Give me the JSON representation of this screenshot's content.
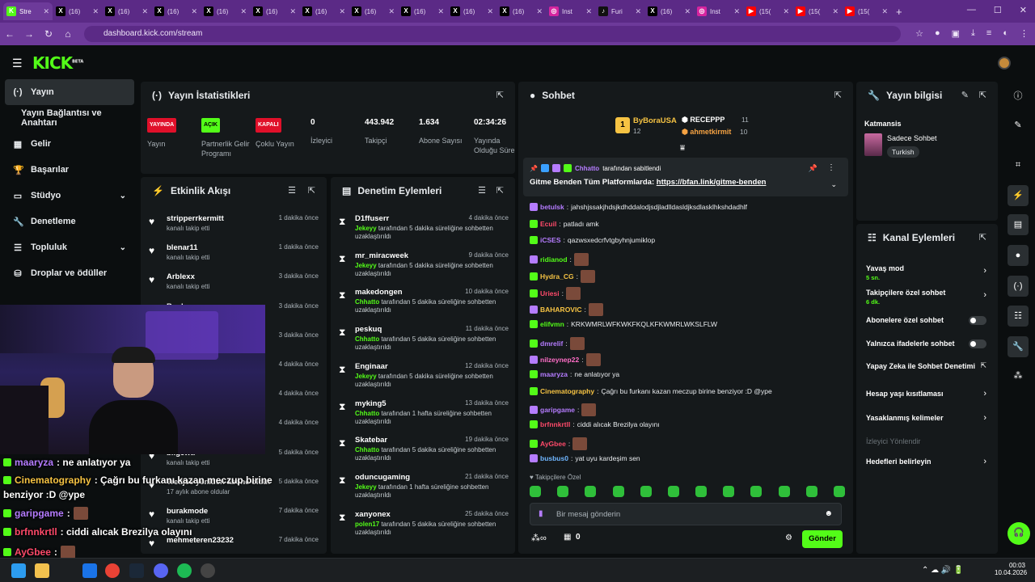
{
  "browser": {
    "tabs": [
      {
        "label": "Stre",
        "fav": "K",
        "color": "#53fc18",
        "active": true
      },
      {
        "label": "(16)",
        "fav": "X",
        "color": "#000"
      },
      {
        "label": "(16)",
        "fav": "X",
        "color": "#000"
      },
      {
        "label": "(16)",
        "fav": "X",
        "color": "#000"
      },
      {
        "label": "(16)",
        "fav": "X",
        "color": "#000"
      },
      {
        "label": "(16)",
        "fav": "X",
        "color": "#000"
      },
      {
        "label": "(16)",
        "fav": "X",
        "color": "#000"
      },
      {
        "label": "(16)",
        "fav": "X",
        "color": "#000"
      },
      {
        "label": "(16)",
        "fav": "X",
        "color": "#000"
      },
      {
        "label": "(16)",
        "fav": "X",
        "color": "#000"
      },
      {
        "label": "(16)",
        "fav": "X",
        "color": "#000"
      },
      {
        "label": "Inst",
        "fav": "◎",
        "color": "#d6249f"
      },
      {
        "label": "Furi",
        "fav": "♪",
        "color": "#111"
      },
      {
        "label": "(16)",
        "fav": "X",
        "color": "#000"
      },
      {
        "label": "Inst",
        "fav": "◎",
        "color": "#d6249f"
      },
      {
        "label": "(15(",
        "fav": "▶",
        "color": "#f00"
      },
      {
        "label": "(15(",
        "fav": "▶",
        "color": "#f00"
      },
      {
        "label": "(15(",
        "fav": "▶",
        "color": "#f00"
      }
    ],
    "url": "dashboard.kick.com/stream"
  },
  "sidebar": {
    "items": [
      {
        "label": "Yayın",
        "icon": "broadcast-icon"
      },
      {
        "label": "Yayın Bağlantısı ve Anahtarı",
        "icon": ""
      },
      {
        "label": "Gelir",
        "icon": "grid-icon"
      },
      {
        "label": "Başarılar",
        "icon": "trophy-icon"
      },
      {
        "label": "Stüdyo",
        "icon": "studio-icon"
      },
      {
        "label": "Denetleme",
        "icon": "wrench-icon"
      },
      {
        "label": "Topluluk",
        "icon": "people-icon"
      },
      {
        "label": "Droplar ve ödüller",
        "icon": "gift-icon"
      }
    ]
  },
  "stats": {
    "title": "Yayın İstatistikleri",
    "cols": [
      {
        "badge": "YAYINDA",
        "badge_color": "#e0102a",
        "label": "Yayın"
      },
      {
        "badge": "AÇIK",
        "badge_color": "#53fc18",
        "label": "Partnerlik Gelir Programı"
      },
      {
        "badge": "KAPALI",
        "badge_color": "#e0102a",
        "label": "Çoklu Yayın"
      },
      {
        "value": "0",
        "label": "İzleyici"
      },
      {
        "value": "443.942",
        "label": "Takipçi"
      },
      {
        "value": "1.634",
        "label": "Abone Sayısı"
      },
      {
        "value": "02:34:26",
        "label": "Yayında Olduğu Süre"
      }
    ]
  },
  "activity": {
    "title": "Etkinlik Akışı",
    "items": [
      {
        "name": "stripperrkermitt",
        "sub": "kanalı takip etti",
        "time": "1 dakika önce"
      },
      {
        "name": "blenar11",
        "sub": "kanalı takip etti",
        "time": "1 dakika önce"
      },
      {
        "name": "Arblexx",
        "sub": "kanalı takip etti",
        "time": "3 dakika önce"
      },
      {
        "name": "Boxl",
        "sub": "",
        "time": "3 dakika önce"
      },
      {
        "name": "",
        "sub": "",
        "time": "3 dakika önce"
      },
      {
        "name": "",
        "sub": "",
        "time": "4 dakika önce"
      },
      {
        "name": "",
        "sub": "",
        "time": "4 dakika önce"
      },
      {
        "name": "me",
        "sub": "",
        "time": "4 dakika önce"
      },
      {
        "name": "bilgewtr",
        "sub": "kanalı takip etti",
        "time": "5 dakika önce"
      },
      {
        "name": "Tredjee yeniden abone oldu!",
        "sub": "17 aylık abone oldular",
        "time": "5 dakika önce"
      },
      {
        "name": "burakmode",
        "sub": "kanalı takip etti",
        "time": "7 dakika önce"
      },
      {
        "name": "mehmeteren23232",
        "sub": "",
        "time": "7 dakika önce"
      }
    ]
  },
  "moderation": {
    "title": "Denetim Eylemleri",
    "items": [
      {
        "name": "D1ffuserr",
        "mod": "Jekeyy",
        "text": " tarafından 5 dakika süreliğine sohbetten uzaklaştırıldı",
        "time": "4 dakika önce"
      },
      {
        "name": "mr_miracweek",
        "mod": "Jekeyy",
        "text": " tarafından 5 dakika süreliğine sohbetten uzaklaştırıldı",
        "time": "9 dakika önce"
      },
      {
        "name": "makedongen",
        "mod": "Chhatto",
        "text": " tarafından 5 dakika süreliğine sohbetten uzaklaştırıldı",
        "time": "10 dakika önce"
      },
      {
        "name": "peskuq",
        "mod": "Chhatto",
        "text": " tarafından 5 dakika süreliğine sohbetten uzaklaştırıldı",
        "time": "11 dakika önce"
      },
      {
        "name": "Enginaar",
        "mod": "Jekeyy",
        "text": " tarafından 5 dakika süreliğine sohbetten uzaklaştırıldı",
        "time": "12 dakika önce"
      },
      {
        "name": "myking5",
        "mod": "Chhatto",
        "text": " tarafından 1 hafta süreliğine sohbetten uzaklaştırıldı",
        "time": "13 dakika önce"
      },
      {
        "name": "Skatebar",
        "mod": "Chhatto",
        "text": " tarafından 5 dakika süreliğine sohbetten uzaklaştırıldı",
        "time": "19 dakika önce"
      },
      {
        "name": "oduncugaming",
        "mod": "Jekeyy",
        "text": " tarafından 1 hafta süreliğine sohbetten uzaklaştırıldı",
        "time": "21 dakika önce"
      },
      {
        "name": "xanyonex",
        "mod": "polen17",
        "text": " tarafından 5 dakika süreliğine sohbetten uzaklaştırıldı",
        "time": "25 dakika önce"
      }
    ]
  },
  "chat": {
    "title": "Sohbet",
    "top_gifters": [
      {
        "name": "ByBoraUSA",
        "count": "12"
      },
      {
        "name": "RECEPPP",
        "count": "11"
      },
      {
        "name": "ahmetkirmit",
        "count": "10"
      }
    ],
    "pinned_by": "Chhatto",
    "pinned_by_suffix": "tarafından sabitlendi",
    "pinned_text": "Gitme Benden Tüm Platformlarda: ",
    "pinned_link": "https://bfan.link/gitme-benden",
    "messages": [
      {
        "user": "betulsk",
        "color": "#b57cff",
        "text": "jahshjssakjhdsjkdhddalodjsdjladlldasldjksdlasklhkshdadhlf",
        "emote": false
      },
      {
        "user": "Ecuil",
        "color": "#ff4a6a",
        "text": "patladı amk",
        "emote": false
      },
      {
        "user": "iCSES",
        "color": "#b57cff",
        "text": "qazwsxedcrfvtgbyhnjumiklop",
        "emote": false
      },
      {
        "user": "ridianod",
        "color": "#53fc18",
        "text": "",
        "emote": true
      },
      {
        "user": "Hydra_CG",
        "color": "#f6c343",
        "text": "",
        "emote": true
      },
      {
        "user": "Uriesi",
        "color": "#ff4a6a",
        "text": "",
        "emote": true
      },
      {
        "user": "BAHAROVIC",
        "color": "#f6c343",
        "text": "",
        "emote": true
      },
      {
        "user": "elifvmn",
        "color": "#53fc18",
        "text": "KRKWMRLWFKWKFKQLKFKWMRLWKSLFLW",
        "emote": false
      },
      {
        "user": "dmrelif",
        "color": "#b57cff",
        "text": "",
        "emote": true
      },
      {
        "user": "nilzeynep22",
        "color": "#ff6ec7",
        "text": "",
        "emote": true
      },
      {
        "user": "maaryza",
        "color": "#b57cff",
        "text": "ne anlatıyor ya",
        "emote": false
      },
      {
        "user": "Cinematography",
        "color": "#f6c343",
        "text": "Çağrı bu furkanı kazan meczup birine benziyor :D @ype",
        "emote": false
      },
      {
        "user": "garipgame",
        "color": "#b57cff",
        "text": "",
        "emote": true
      },
      {
        "user": "brfnnkrtll",
        "color": "#ff4a6a",
        "text": "ciddi alıcak Brezilya olayını",
        "emote": false
      },
      {
        "user": "AyGbee",
        "color": "#ff4a6a",
        "text": "",
        "emote": true
      },
      {
        "user": "busbus0",
        "color": "#6fb6ff",
        "text": "yat uyu kardeşim sen",
        "emote": false
      }
    ],
    "followers_only_label": "Takipçilere Özel",
    "input_placeholder": "Bir mesaj gönderin",
    "points": "0",
    "send_label": "Gönder"
  },
  "stream_info": {
    "title": "Yayın bilgisi",
    "category_label": "Katmansis",
    "category_name": "Sadece Sohbet",
    "tag": "Turkish"
  },
  "channel_actions": {
    "title": "Kanal Eylemleri",
    "items": [
      {
        "label": "Yavaş mod",
        "sub": "5 sn.",
        "control": "chevron"
      },
      {
        "label": "Takipçilere özel sohbet",
        "sub": "6 dk.",
        "control": "chevron"
      },
      {
        "label": "Abonelere özel sohbet",
        "sub": "",
        "control": "toggle"
      },
      {
        "label": "Yalnızca ifadelerle sohbet",
        "sub": "",
        "control": "toggle"
      },
      {
        "label": "Yapay Zeka ile Sohbet Denetimi",
        "sub": "",
        "control": "external"
      },
      {
        "label": "Hesap yaşı kısıtlaması",
        "sub": "",
        "control": "chevron"
      },
      {
        "label": "Yasaklanmış kelimeler",
        "sub": "",
        "control": "chevron"
      },
      {
        "label": "İzleyici Yönlendir",
        "sub": "",
        "control": "none"
      },
      {
        "label": "Hedefleri belirleyin",
        "sub": "",
        "control": "chevron"
      }
    ]
  },
  "overlay_chat": [
    {
      "user": "maaryza",
      "color": "#b57cff",
      "text": " : ne anlatıyor ya"
    },
    {
      "user": "Cinematography",
      "color": "#f6c343",
      "text": " : Çağrı bu furkanı kazan meczup birine"
    },
    {
      "user": "",
      "color": "#fff",
      "text": "benziyor :D @ype"
    },
    {
      "user": "garipgame",
      "color": "#b57cff",
      "text": " :"
    },
    {
      "user": "brfnnkrtll",
      "color": "#ff4a6a",
      "text": " : ciddi alıcak Brezilya olayını"
    },
    {
      "user": "AyGbee",
      "color": "#ff4a6a",
      "text": " :"
    }
  ],
  "taskbar": {
    "time": "00:03",
    "date": "10.04.2026"
  }
}
